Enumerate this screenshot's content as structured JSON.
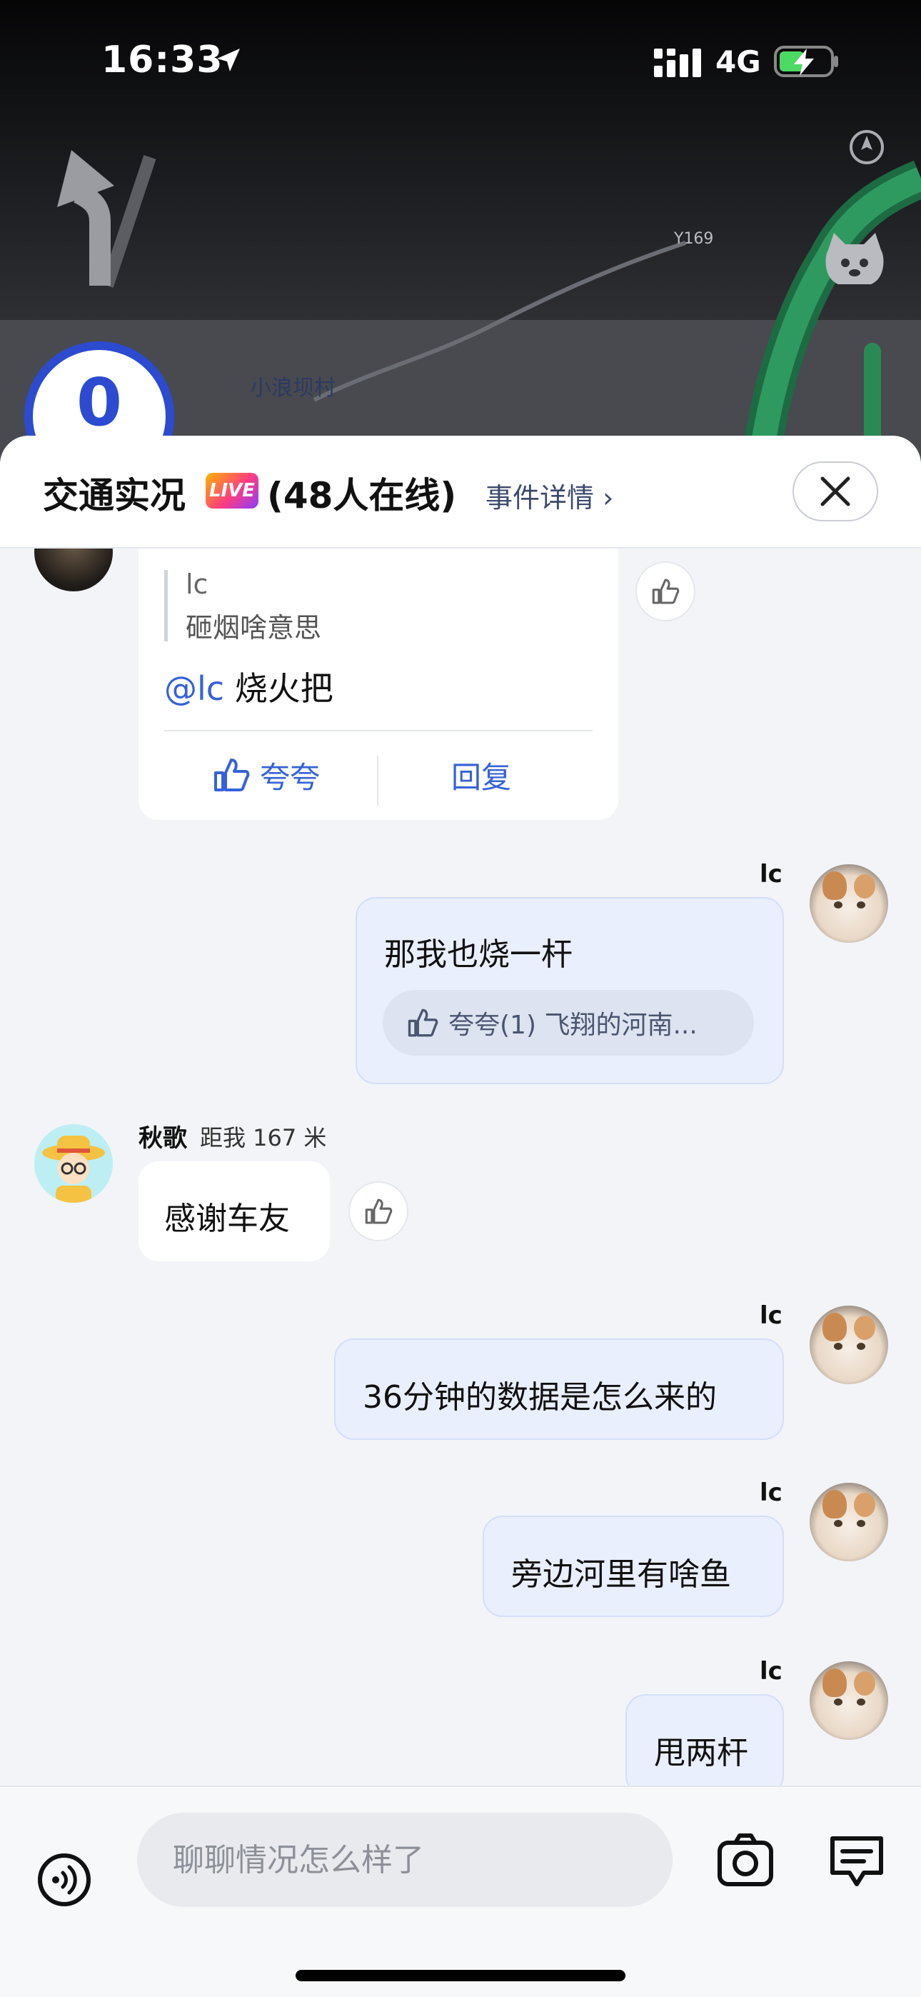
{
  "status_bar": {
    "time": "16:33",
    "network": "4G"
  },
  "map": {
    "road_label": "Y169",
    "village_label": "小浪坝村",
    "speed": "0"
  },
  "header": {
    "title": "交通实况",
    "live_badge": "LIVE",
    "online_count": "(48人在线)",
    "detail_link": "事件详情",
    "chevron": "›"
  },
  "messages": {
    "card": {
      "quote_name": "lc",
      "quote_text": "砸烟啥意思",
      "mention": "@lc",
      "reply_text": "烧火把",
      "praise_label": "夸夸",
      "reply_label": "回复"
    },
    "m1": {
      "sender": "lc",
      "text": "那我也烧一杆",
      "praise": "夸夸(1) 飞翔的河南..."
    },
    "m2": {
      "sender": "秋歌",
      "distance": "距我 167 米",
      "text": "感谢车友"
    },
    "m3": {
      "sender": "lc",
      "text": "36分钟的数据是怎么来的"
    },
    "m4": {
      "sender": "lc",
      "text": "旁边河里有啥鱼"
    },
    "m5": {
      "sender": "lc",
      "text": "甩两杆"
    }
  },
  "input": {
    "placeholder": "聊聊情况怎么样了"
  },
  "colors": {
    "accent": "#3562d9",
    "live_gradient_start": "#ffb400",
    "live_gradient_end": "#8a3dff"
  }
}
